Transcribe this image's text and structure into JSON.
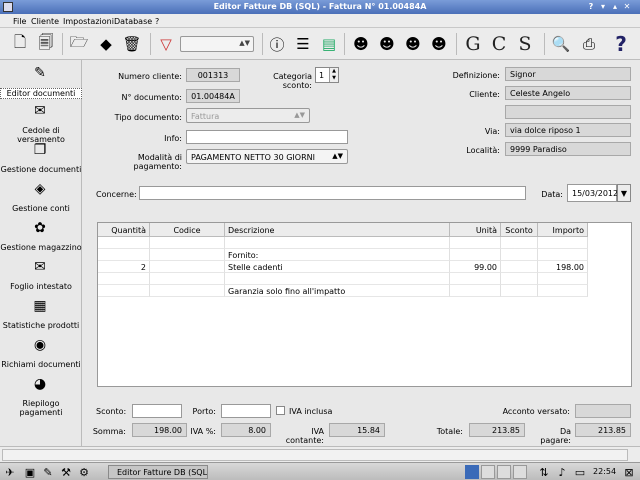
{
  "window": {
    "title": "Editor Fatture DB (SQL) - Fattura N° 01.00484A"
  },
  "menu": [
    "File",
    "Cliente",
    "Impostazioni",
    "Database",
    "?"
  ],
  "toolbar": {
    "icons": [
      "new-document-icon",
      "copy-document-icon",
      "open-folder-icon",
      "save-disk-icon",
      "trash-icon",
      "filter-icon",
      "info-icon",
      "list-icon",
      "money-icon",
      "user-search-icon",
      "user-new-icon",
      "user-edit-icon",
      "user-delete-icon",
      "print-preview-icon",
      "printer-icon",
      "help-icon"
    ],
    "letters": [
      "G",
      "C",
      "S"
    ],
    "filter_value": ""
  },
  "sidebar": [
    {
      "label": "Editor documenti",
      "icon": "pencil-icon",
      "glyph": "✎",
      "active": true
    },
    {
      "label": "Cedole di versamento",
      "icon": "payment-slip-icon",
      "glyph": "✉"
    },
    {
      "label": "Gestione documenti",
      "icon": "documents-icon",
      "glyph": "❐"
    },
    {
      "label": "Gestione conti",
      "icon": "accounts-icon",
      "glyph": "◈"
    },
    {
      "label": "Gestione magazzino",
      "icon": "warehouse-icon",
      "glyph": "✿"
    },
    {
      "label": "Foglio intestato",
      "icon": "letterhead-icon",
      "glyph": "✉"
    },
    {
      "label": "Statistiche prodotti",
      "icon": "chart-icon",
      "glyph": "▦"
    },
    {
      "label": "Richiami documenti",
      "icon": "reminder-icon",
      "glyph": "◉"
    },
    {
      "label": "Riepilogo pagamenti",
      "icon": "pie-chart-icon",
      "glyph": "◕"
    }
  ],
  "form": {
    "numero_cliente_label": "Numero cliente:",
    "numero_cliente": "001313",
    "categoria_sconto_label": "Categoria sconto:",
    "categoria_sconto": "1",
    "n_documento_label": "N° documento:",
    "n_documento": "01.00484A",
    "tipo_documento_label": "Tipo documento:",
    "tipo_documento": "Fattura",
    "info_label": "Info:",
    "info": "",
    "pagamento_label": "Modalità di pagamento:",
    "pagamento": "PAGAMENTO NETTO 30 GIORNI",
    "definizione_label": "Definizione:",
    "definizione": "Signor",
    "cliente_label": "Cliente:",
    "cliente": "Celeste Angelo",
    "cliente2": "",
    "via_label": "Via:",
    "via": "via dolce riposo 1",
    "localita_label": "Località:",
    "localita": "9999 Paradiso",
    "concerne_label": "Concerne:",
    "concerne": "",
    "data_label": "Data:",
    "data": "15/03/2012"
  },
  "table": {
    "headers": [
      "Quantità",
      "Codice",
      "Descrizione",
      "Unità",
      "Sconto",
      "Importo"
    ],
    "rows": [
      [
        "",
        "",
        "",
        "",
        "",
        ""
      ],
      [
        "",
        "",
        "Fornito:",
        "",
        "",
        ""
      ],
      [
        "2",
        "",
        "Stelle cadenti",
        "99.00",
        "",
        "198.00"
      ],
      [
        "",
        "",
        "",
        "",
        "",
        ""
      ],
      [
        "",
        "",
        "Garanzia solo fino all'impatto",
        "",
        "",
        ""
      ]
    ]
  },
  "totals": {
    "sconto_label": "Sconto:",
    "sconto": "",
    "porto_label": "Porto:",
    "porto": "",
    "iva_inclusa_label": "IVA inclusa",
    "acconto_label": "Acconto versato:",
    "acconto": "",
    "somma_label": "Somma:",
    "somma": "198.00",
    "iva_pct_label": "IVA %:",
    "iva_pct": "8.00",
    "iva_contante_label": "IVA contante:",
    "iva_contante": "15.84",
    "totale_label": "Totale:",
    "totale": "213.85",
    "da_pagare_label": "Da pagare:",
    "da_pagare": "213.85"
  },
  "taskbar": {
    "task": "Editor Fatture DB (SQL...",
    "clock": "22:54"
  }
}
